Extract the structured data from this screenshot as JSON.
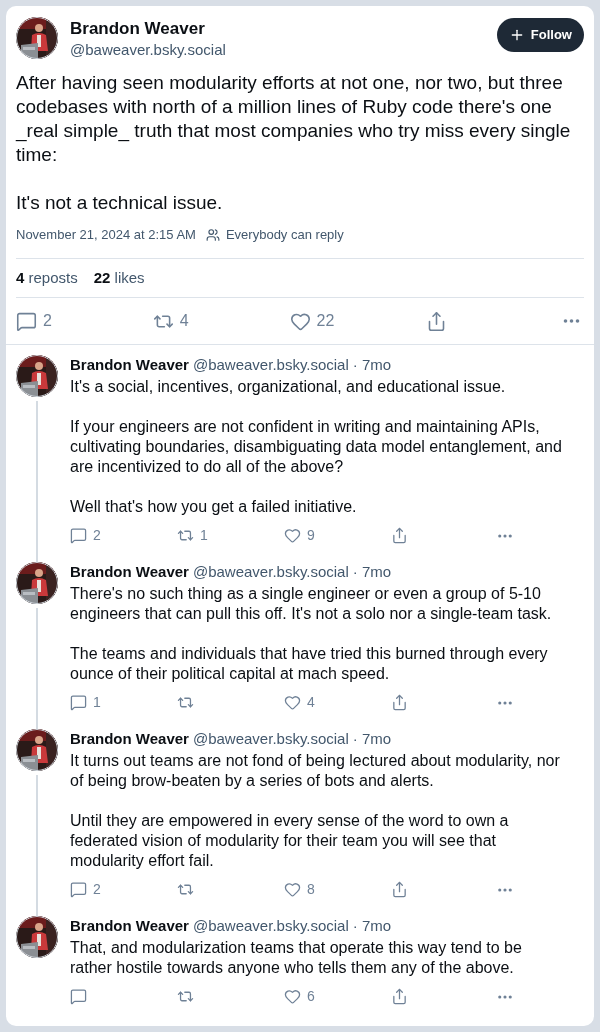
{
  "post": {
    "author": {
      "name": "Brandon Weaver",
      "handle": "@baweaver.bsky.social"
    },
    "follow_button": {
      "label": "Follow"
    },
    "text": "After having seen modularity efforts at not one, nor two, but three codebases with north of a million lines of Ruby code there's one _real simple_ truth that most companies who try miss every single time:\n\nIt's not a technical issue.",
    "timestamp": "November 21, 2024 at 2:15 AM",
    "reply_setting": "Everybody can reply",
    "stats": [
      {
        "count": "4",
        "label": "reposts"
      },
      {
        "count": "22",
        "label": "likes"
      }
    ],
    "actions": [
      {
        "kind": "reply",
        "count": "2"
      },
      {
        "kind": "repost",
        "count": "4"
      },
      {
        "kind": "like",
        "count": "22"
      },
      {
        "kind": "share"
      },
      {
        "kind": "more"
      }
    ]
  },
  "replies": [
    {
      "name": "Brandon Weaver",
      "handle": "@baweaver.bsky.social",
      "age": "· 7mo",
      "thread_continues": true,
      "text": "It's a social, incentives, organizational, and educational issue.\n\nIf your engineers are not confident in writing and maintaining APIs, cultivating boundaries, disambiguating data model entanglement, and are incentivized to do all of the above?\n\nWell that's how you get a failed initiative.",
      "actions": [
        {
          "kind": "reply",
          "count": "2"
        },
        {
          "kind": "repost",
          "count": "1"
        },
        {
          "kind": "like",
          "count": "9"
        },
        {
          "kind": "share"
        },
        {
          "kind": "more"
        }
      ]
    },
    {
      "name": "Brandon Weaver",
      "handle": "@baweaver.bsky.social",
      "age": "· 7mo",
      "thread_continues": true,
      "text": "There's no such thing as a single engineer or even a group of 5-10 engineers that can pull this off. It's not a solo nor a single-team task.\n\nThe teams and individuals that have tried this burned through every ounce of their political capital at mach speed.",
      "actions": [
        {
          "kind": "reply",
          "count": "1"
        },
        {
          "kind": "repost"
        },
        {
          "kind": "like",
          "count": "4"
        },
        {
          "kind": "share"
        },
        {
          "kind": "more"
        }
      ]
    },
    {
      "name": "Brandon Weaver",
      "handle": "@baweaver.bsky.social",
      "age": "· 7mo",
      "thread_continues": true,
      "text": "It turns out teams are not fond of being lectured about modularity, nor of being brow-beaten by a series of bots and alerts.\n\nUntil they are empowered in every sense of the word to own a federated vision of modularity for their team you will see that modularity effort fail.",
      "actions": [
        {
          "kind": "reply",
          "count": "2"
        },
        {
          "kind": "repost"
        },
        {
          "kind": "like",
          "count": "8"
        },
        {
          "kind": "share"
        },
        {
          "kind": "more"
        }
      ]
    },
    {
      "name": "Brandon Weaver",
      "handle": "@baweaver.bsky.social",
      "age": "· 7mo",
      "thread_continues": false,
      "text": "That, and modularization teams that operate this way tend to be rather hostile towards anyone who tells them any of the above.",
      "actions": [
        {
          "kind": "reply"
        },
        {
          "kind": "repost"
        },
        {
          "kind": "like",
          "count": "6"
        },
        {
          "kind": "share"
        },
        {
          "kind": "more"
        }
      ]
    }
  ]
}
